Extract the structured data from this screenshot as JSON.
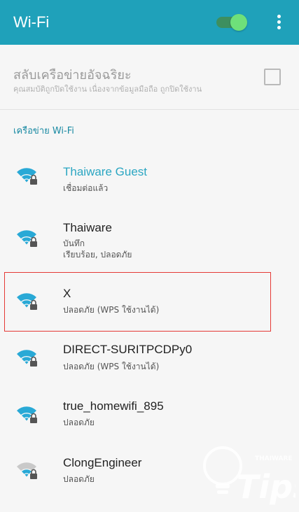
{
  "appbar": {
    "title": "Wi-Fi",
    "toggle_on": true,
    "accent": "#1fa1ba"
  },
  "smart_network": {
    "title": "สลับเครือข่ายอัจฉริยะ",
    "subtitle": "คุณสมบัติถูกปิดใช้งาน เนื่องจากข้อมูลมือถือ ถูกปิดใช้งาน",
    "checked": false
  },
  "section": {
    "label": "เครือข่าย Wi-Fi"
  },
  "networks": [
    {
      "name": "Thaiware Guest",
      "sub1": "เชื่อมต่อแล้ว",
      "sub2": "",
      "icon": "wifi-lock-icon",
      "connected": true
    },
    {
      "name": "Thaiware",
      "sub1": "บันทึก",
      "sub2": "เรียบร้อย, ปลอดภัย",
      "icon": "wifi-lock-icon",
      "connected": false
    },
    {
      "name": "X",
      "sub1": "ปลอดภัย (WPS ใช้งานได้)",
      "sub2": "",
      "icon": "wifi-lock-icon",
      "connected": false
    },
    {
      "name": "DIRECT-SURITPCDPy0",
      "sub1": "ปลอดภัย (WPS ใช้งานได้)",
      "sub2": "",
      "icon": "wifi-lock-icon",
      "connected": false
    },
    {
      "name": "true_homewifi_895",
      "sub1": "ปลอดภัย",
      "sub2": "",
      "icon": "wifi-lock-icon",
      "connected": false
    },
    {
      "name": "ClongEngineer",
      "sub1": "ปลอดภัย",
      "sub2": "",
      "icon": "wifi-lock-weak-icon",
      "connected": false
    }
  ],
  "watermark": {
    "brand": "THAIWARE",
    "word": "Tips"
  },
  "colors": {
    "wifi_blue": "#29a9d6",
    "wifi_gray": "#a9a9a9",
    "lock": "#555555",
    "highlight": "#e53935"
  }
}
